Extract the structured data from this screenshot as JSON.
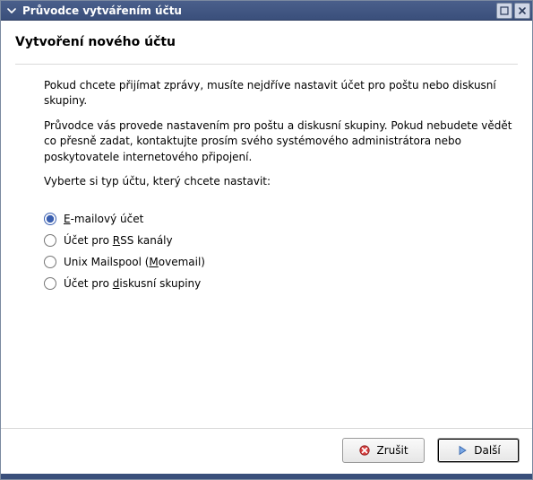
{
  "window": {
    "title": "Průvodce vytvářením účtu"
  },
  "page": {
    "heading": "Vytvoření nového účtu",
    "intro1": "Pokud chcete přijímat zprávy, musíte nejdříve nastavit účet pro poštu nebo diskusní skupiny.",
    "intro2": "Průvodce vás provede nastavením pro poštu a diskusní skupiny. Pokud nebudete vědět co přesně zadat, kontaktujte prosím svého systémového administrátora nebo poskytovatele internetového připojení.",
    "prompt": "Vyberte si typ účtu, který chcete nastavit:"
  },
  "options": {
    "email": {
      "prefix": "",
      "accel": "E",
      "suffix": "-mailový účet",
      "selected": true
    },
    "rss": {
      "prefix": "Účet pro ",
      "accel": "R",
      "suffix": "SS kanály",
      "selected": false
    },
    "unix": {
      "prefix": "Unix Mailspool (",
      "accel": "M",
      "suffix": "ovemail)",
      "selected": false
    },
    "news": {
      "prefix": "Účet pro ",
      "accel": "d",
      "suffix": "iskusní skupiny",
      "selected": false
    }
  },
  "footer": {
    "cancel": "Zrušit",
    "next": "Další"
  },
  "icons": {
    "chevron": "chevron-down-icon",
    "minimize": "minimize-icon",
    "close": "close-icon",
    "cancel": "cancel-icon",
    "next": "play-icon"
  }
}
